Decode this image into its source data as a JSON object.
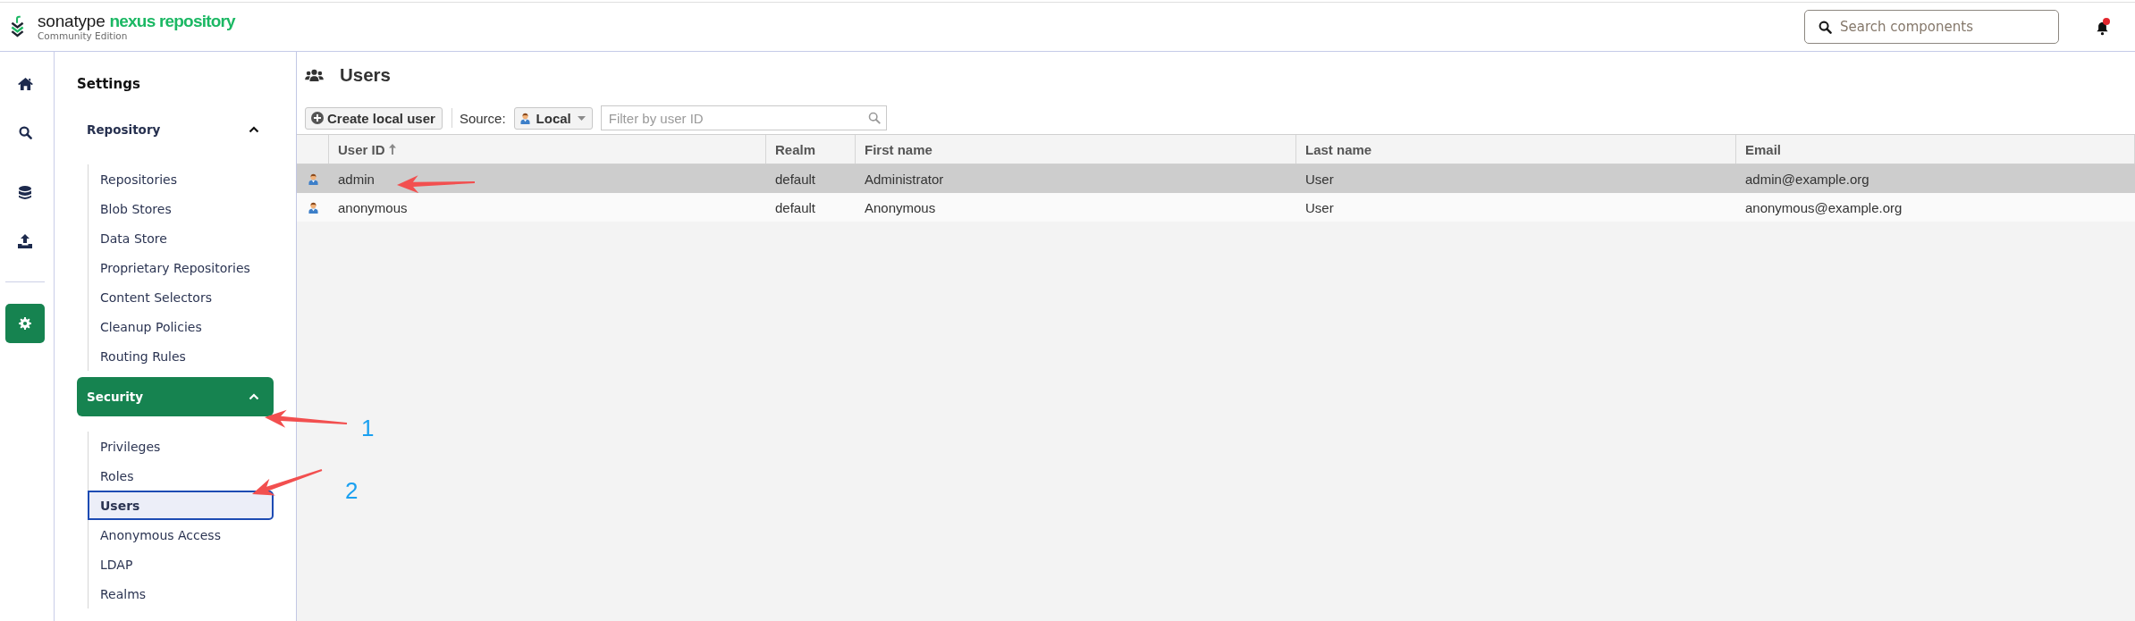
{
  "header": {
    "logo": {
      "brand": "sonatype",
      "product": "nexus repository",
      "edition": "Community Edition"
    },
    "search": {
      "placeholder": "Search components"
    },
    "notifications": {
      "unread": true
    }
  },
  "rail": {
    "primary": [
      {
        "kind": "home",
        "selected": false
      },
      {
        "kind": "search",
        "selected": false
      },
      {
        "kind": "database",
        "selected": false
      },
      {
        "kind": "upload",
        "selected": false
      }
    ],
    "secondary": [
      {
        "kind": "settings",
        "selected": true
      }
    ]
  },
  "sidebar": {
    "title": "Settings",
    "sections": [
      {
        "label": "Repository",
        "selected": false,
        "expanded": true,
        "items": [
          {
            "label": "Repositories",
            "selected": false
          },
          {
            "label": "Blob Stores",
            "selected": false
          },
          {
            "label": "Data Store",
            "selected": false
          },
          {
            "label": "Proprietary Repositories",
            "selected": false
          },
          {
            "label": "Content Selectors",
            "selected": false
          },
          {
            "label": "Cleanup Policies",
            "selected": false
          },
          {
            "label": "Routing Rules",
            "selected": false
          }
        ]
      },
      {
        "label": "Security",
        "selected": true,
        "expanded": true,
        "items": [
          {
            "label": "Privileges",
            "selected": false
          },
          {
            "label": "Roles",
            "selected": false
          },
          {
            "label": "Users",
            "selected": true
          },
          {
            "label": "Anonymous Access",
            "selected": false
          },
          {
            "label": "LDAP",
            "selected": false
          },
          {
            "label": "Realms",
            "selected": false
          }
        ]
      }
    ]
  },
  "page": {
    "title": "Users",
    "toolbar": {
      "create_button": "Create local user",
      "source_label": "Source:",
      "source_value": "Local",
      "filter": {
        "placeholder": "Filter by user ID"
      }
    },
    "table": {
      "columns": [
        {
          "label": "User ID",
          "sorted": true
        },
        {
          "label": "Realm",
          "sorted": false
        },
        {
          "label": "First name",
          "sorted": false
        },
        {
          "label": "Last name",
          "sorted": false
        },
        {
          "label": "Email",
          "sorted": false
        }
      ],
      "rows": [
        {
          "selected": true,
          "cells": [
            "admin",
            "default",
            "Administrator",
            "User",
            "admin@example.org"
          ]
        },
        {
          "selected": false,
          "cells": [
            "anonymous",
            "default",
            "Anonymous",
            "User",
            "anonymous@example.org"
          ]
        }
      ]
    }
  },
  "annotations": [
    {
      "kind": "numbered",
      "label": "1"
    },
    {
      "kind": "numbered",
      "label": "2"
    },
    {
      "kind": "plain"
    }
  ]
}
